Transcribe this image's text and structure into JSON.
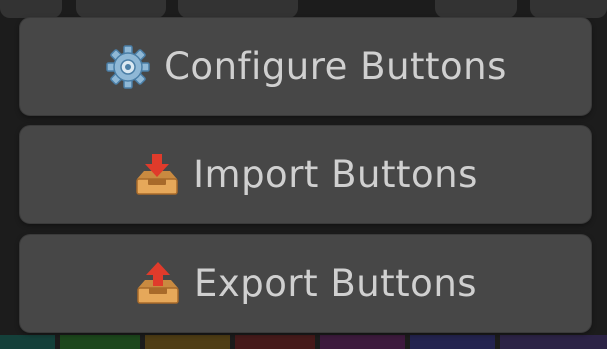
{
  "menu": {
    "items": [
      {
        "label": "Configure Buttons",
        "icon": "gear-icon"
      },
      {
        "label": "Import Buttons",
        "icon": "tray-import-icon"
      },
      {
        "label": "Export Buttons",
        "icon": "tray-export-icon"
      }
    ]
  },
  "colors": {
    "menu_item_bg": "#474747",
    "menu_label": "#d0d0d0",
    "backdrop": "#1c1c1c"
  }
}
